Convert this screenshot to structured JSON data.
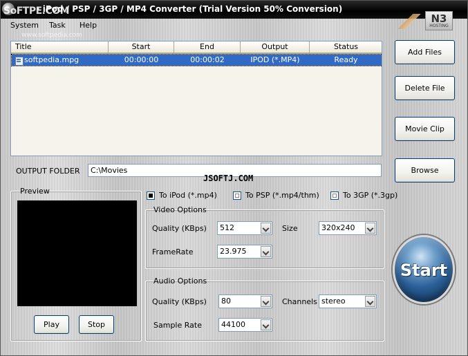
{
  "window": {
    "title": "· iPod / PSP / 3GP / MP4 Converter (Trial Version 50% Conversion)",
    "watermark_overlay": "SoFTPE.COM",
    "menu_url": "www.softpedia.com"
  },
  "menu": {
    "items": [
      "System",
      "Task",
      "Help"
    ]
  },
  "hosting_logo": {
    "mark": "N3",
    "caption": "HOSTING"
  },
  "file_table": {
    "columns": [
      "Title",
      "Start",
      "End",
      "Output",
      "Status"
    ],
    "rows": [
      {
        "title": "softpedia.mpg",
        "start": "00:00:00",
        "end": "00:00:02",
        "output": "IPOD (*.MP4)",
        "status": "Ready"
      }
    ]
  },
  "buttons": {
    "add_files": "Add Files",
    "delete_file": "Delete File",
    "movie_clip": "Movie Clip",
    "browse": "Browse",
    "play": "Play",
    "stop": "Stop",
    "start": "Start"
  },
  "output_folder": {
    "label": "OUTPUT FOLDER",
    "value": "C:\\Movies"
  },
  "watermark": "JSOFTJ.COM",
  "preview": {
    "label": "Preview"
  },
  "format_options": {
    "ipod": {
      "label": "To iPod (*.mp4)",
      "checked": true
    },
    "psp": {
      "label": "To PSP (*.mp4/thm)",
      "checked": false
    },
    "3gp": {
      "label": "To 3GP (*.3gp)",
      "checked": false
    }
  },
  "video_options": {
    "title": "Video Options",
    "quality_label": "Quality (KBps)",
    "quality_value": "512",
    "size_label": "Size",
    "size_value": "320x240",
    "framerate_label": "FrameRate",
    "framerate_value": "23.975"
  },
  "audio_options": {
    "title": "Audio Options",
    "quality_label": "Quality (KBps)",
    "quality_value": "80",
    "channels_label": "Channels",
    "channels_value": "stereo",
    "samplerate_label": "Sample Rate",
    "samplerate_value": "44100"
  },
  "colors": {
    "selection": "#316ac5",
    "start_button": "#2b5f96"
  }
}
